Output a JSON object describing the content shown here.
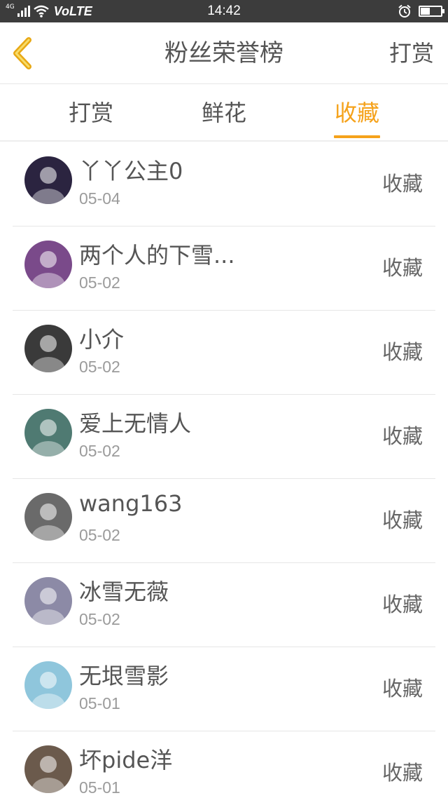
{
  "status_bar": {
    "network": "4G",
    "volte": "VoLTE",
    "time": "14:42",
    "battery_level": 0.45
  },
  "header": {
    "title": "粉丝荣誉榜",
    "action_label": "打赏"
  },
  "tabs": [
    {
      "label": "打赏",
      "active": false
    },
    {
      "label": "鲜花",
      "active": false
    },
    {
      "label": "收藏",
      "active": true
    }
  ],
  "colors": {
    "accent": "#f5a21b",
    "status_bar": "#3c3c3c"
  },
  "fans": [
    {
      "name": "丫丫公主0",
      "date": "05-04",
      "action": "收藏",
      "avatar_color": "#2b2440"
    },
    {
      "name": "两个人的下雪...",
      "date": "05-02",
      "action": "收藏",
      "avatar_color": "#7a4a8a"
    },
    {
      "name": "小介",
      "date": "05-02",
      "action": "收藏",
      "avatar_color": "#3a3a3a"
    },
    {
      "name": "爱上无情人",
      "date": "05-02",
      "action": "收藏",
      "avatar_color": "#4f7a72"
    },
    {
      "name": "wang163",
      "date": "05-02",
      "action": "收藏",
      "avatar_color": "#6a6a6a"
    },
    {
      "name": "冰雪无薇",
      "date": "05-02",
      "action": "收藏",
      "avatar_color": "#8c8aa6"
    },
    {
      "name": "无垠雪影",
      "date": "05-01",
      "action": "收藏",
      "avatar_color": "#8fc6dc"
    },
    {
      "name": "坏pide洋",
      "date": "05-01",
      "action": "收藏",
      "avatar_color": "#6b5a4c"
    }
  ]
}
